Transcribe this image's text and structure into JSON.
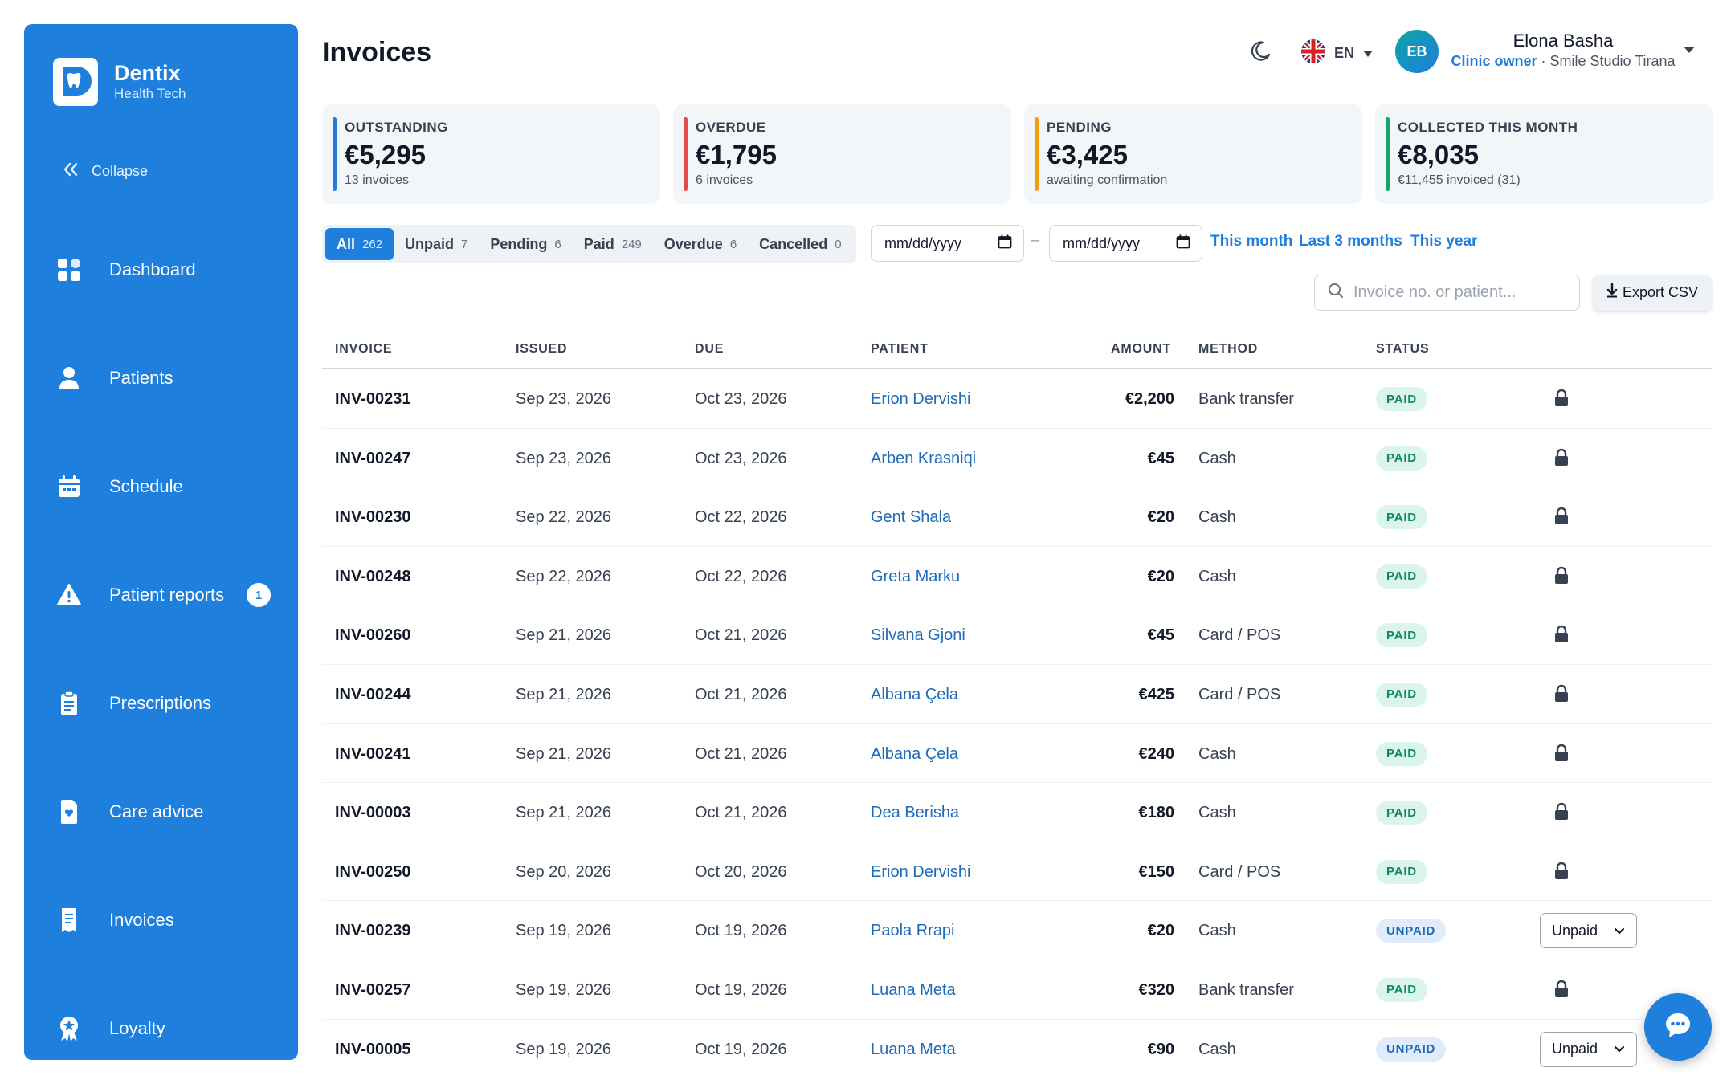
{
  "brand": {
    "name": "Dentix",
    "tagline": "Health Tech"
  },
  "sidebar": {
    "collapse_label": "Collapse",
    "items": [
      {
        "label": "Dashboard",
        "icon": "dashboard-icon"
      },
      {
        "label": "Patients",
        "icon": "user-icon"
      },
      {
        "label": "Schedule",
        "icon": "calendar-icon"
      },
      {
        "label": "Patient reports",
        "icon": "warning-icon",
        "badge": "1"
      },
      {
        "label": "Prescriptions",
        "icon": "clipboard-icon"
      },
      {
        "label": "Care advice",
        "icon": "heart-file-icon"
      },
      {
        "label": "Invoices",
        "icon": "receipt-icon"
      },
      {
        "label": "Loyalty",
        "icon": "award-icon"
      }
    ]
  },
  "header": {
    "title": "Invoices",
    "language": "EN",
    "user": {
      "initials": "EB",
      "name": "Elona Basha",
      "role": "Clinic owner",
      "clinic": " · Smile Studio Tirana"
    }
  },
  "stats": [
    {
      "label": "OUTSTANDING",
      "value": "€5,295",
      "sub": "13 invoices",
      "color": "#1e7fdc"
    },
    {
      "label": "OVERDUE",
      "value": "€1,795",
      "sub": "6 invoices",
      "color": "#e5484d"
    },
    {
      "label": "PENDING",
      "value": "€3,425",
      "sub": "awaiting confirmation",
      "color": "#f59e0b"
    },
    {
      "label": "COLLECTED THIS MONTH",
      "value": "€8,035",
      "sub": "€11,455 invoiced (31)",
      "color": "#16a36a"
    }
  ],
  "filters": {
    "tabs": [
      {
        "label": "All",
        "count": "262"
      },
      {
        "label": "Unpaid",
        "count": "7"
      },
      {
        "label": "Pending",
        "count": "6"
      },
      {
        "label": "Paid",
        "count": "249"
      },
      {
        "label": "Overdue",
        "count": "6"
      },
      {
        "label": "Cancelled",
        "count": "0"
      }
    ],
    "date_from": "mm/dd/yyyy",
    "date_to": "mm/dd/yyyy",
    "date_separator": "–",
    "quick_ranges": [
      "This month",
      "Last 3 months",
      "This year"
    ],
    "search_placeholder": "Invoice no. or patient...",
    "export_label": "Export CSV"
  },
  "table": {
    "headers": [
      "INVOICE",
      "ISSUED",
      "DUE",
      "PATIENT",
      "AMOUNT",
      "METHOD",
      "STATUS"
    ],
    "rows": [
      {
        "invoice": "INV-00231",
        "issued": "Sep 23, 2026",
        "due": "Oct 23, 2026",
        "patient": "Erion Dervishi",
        "amount": "€2,200",
        "method": "Bank transfer",
        "status": "PAID"
      },
      {
        "invoice": "INV-00247",
        "issued": "Sep 23, 2026",
        "due": "Oct 23, 2026",
        "patient": "Arben Krasniqi",
        "amount": "€45",
        "method": "Cash",
        "status": "PAID"
      },
      {
        "invoice": "INV-00230",
        "issued": "Sep 22, 2026",
        "due": "Oct 22, 2026",
        "patient": "Gent Shala",
        "amount": "€20",
        "method": "Cash",
        "status": "PAID"
      },
      {
        "invoice": "INV-00248",
        "issued": "Sep 22, 2026",
        "due": "Oct 22, 2026",
        "patient": "Greta Marku",
        "amount": "€20",
        "method": "Cash",
        "status": "PAID"
      },
      {
        "invoice": "INV-00260",
        "issued": "Sep 21, 2026",
        "due": "Oct 21, 2026",
        "patient": "Silvana Gjoni",
        "amount": "€45",
        "method": "Card / POS",
        "status": "PAID"
      },
      {
        "invoice": "INV-00244",
        "issued": "Sep 21, 2026",
        "due": "Oct 21, 2026",
        "patient": "Albana Çela",
        "amount": "€425",
        "method": "Card / POS",
        "status": "PAID"
      },
      {
        "invoice": "INV-00241",
        "issued": "Sep 21, 2026",
        "due": "Oct 21, 2026",
        "patient": "Albana Çela",
        "amount": "€240",
        "method": "Cash",
        "status": "PAID"
      },
      {
        "invoice": "INV-00003",
        "issued": "Sep 21, 2026",
        "due": "Oct 21, 2026",
        "patient": "Dea Berisha",
        "amount": "€180",
        "method": "Cash",
        "status": "PAID"
      },
      {
        "invoice": "INV-00250",
        "issued": "Sep 20, 2026",
        "due": "Oct 20, 2026",
        "patient": "Erion Dervishi",
        "amount": "€150",
        "method": "Card / POS",
        "status": "PAID"
      },
      {
        "invoice": "INV-00239",
        "issued": "Sep 19, 2026",
        "due": "Oct 19, 2026",
        "patient": "Paola Rrapi",
        "amount": "€20",
        "method": "Cash",
        "status": "UNPAID",
        "action": "Unpaid"
      },
      {
        "invoice": "INV-00257",
        "issued": "Sep 19, 2026",
        "due": "Oct 19, 2026",
        "patient": "Luana Meta",
        "amount": "€320",
        "method": "Bank transfer",
        "status": "PAID"
      },
      {
        "invoice": "INV-00005",
        "issued": "Sep 19, 2026",
        "due": "Oct 19, 2026",
        "patient": "Luana Meta",
        "amount": "€90",
        "method": "Cash",
        "status": "UNPAID",
        "action": "Unpaid"
      }
    ]
  }
}
